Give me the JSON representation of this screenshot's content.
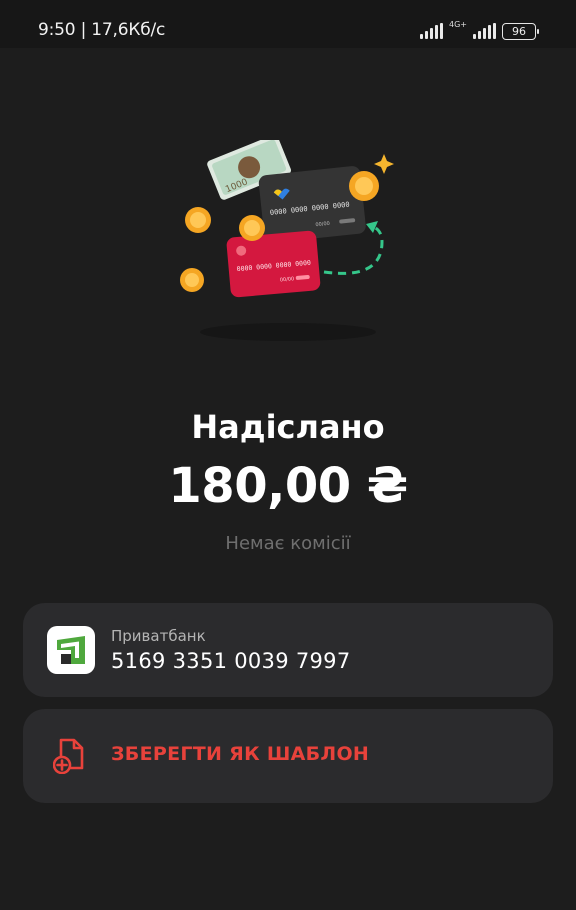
{
  "status_bar": {
    "time_speed": "9:50 | 17,6Кб/с",
    "network": "4G+",
    "battery": "96"
  },
  "illustration": {
    "banknote_value": "1000",
    "card_number_front": "0000 0000 0000 0000",
    "card_number_back": "0000 0000 0000 0000",
    "card_expiry": "00/00"
  },
  "result": {
    "title": "Надіслано",
    "amount": "180,00 ₴",
    "fee_note": "Немає комісії"
  },
  "recipient": {
    "bank_name": "Приватбанк",
    "card_number": "5169 3351 0039 7997",
    "logo_color": "#4fa83d"
  },
  "actions": {
    "save_template_label": "ЗБЕРЕГТИ ЯК ШАБЛОН",
    "accent_color": "#e8423b"
  }
}
